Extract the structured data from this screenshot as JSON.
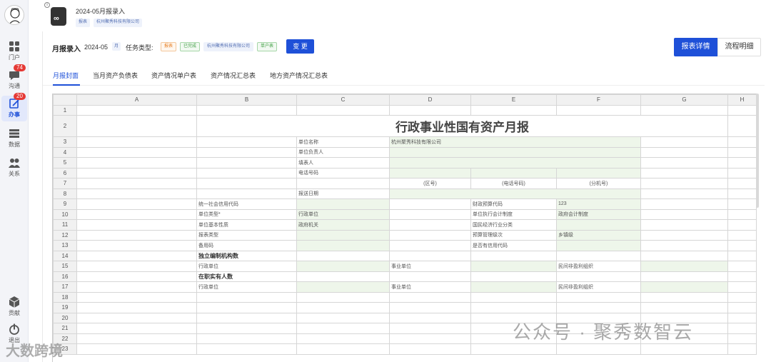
{
  "sidebar": {
    "items": [
      {
        "label": "门户",
        "icon": "grid-icon"
      },
      {
        "label": "沟通",
        "icon": "chat-icon",
        "badge": "74"
      },
      {
        "label": "办事",
        "icon": "edit-icon",
        "badge": "20",
        "active": true
      },
      {
        "label": "数据",
        "icon": "database-icon"
      },
      {
        "label": "关系",
        "icon": "people-icon"
      },
      {
        "label": "贡献",
        "icon": "cube-icon"
      },
      {
        "label": "退出",
        "icon": "power-icon"
      }
    ]
  },
  "header": {
    "title": "2024-05月报录入",
    "tags": [
      "报表",
      "杭州聚秀科技有限公司"
    ]
  },
  "toolbar": {
    "title": "月报录入",
    "month": "2024-05",
    "unit": "月",
    "type_label": "任务类型:",
    "tags": [
      {
        "text": "报表",
        "color": "#e67e22"
      },
      {
        "text": "已完成",
        "color": "#43a047"
      },
      {
        "text": "杭州聚秀科技有限公司",
        "color": "#5570b3"
      },
      {
        "text": "单户表",
        "color": "#43a047"
      }
    ],
    "change_label": "变 更",
    "detail_label": "报表详情",
    "flow_label": "流程明细"
  },
  "tabs": [
    "月报封面",
    "当月资产负债表",
    "资产情况单户表",
    "资产情况汇总表",
    "地方资产情况汇总表"
  ],
  "sheet": {
    "columns": [
      "",
      "A",
      "B",
      "C",
      "D",
      "E",
      "F",
      "G",
      "H"
    ],
    "title": "行政事业性国有资产月报",
    "labels": {
      "unit_name": "单位名称",
      "unit_name_value": "杭州聚秀科技有限公司",
      "unit_head": "单位负责人",
      "filler": "填表人",
      "phone": "电话号码",
      "area_code": "(区号)",
      "phone_no": "(电话号码)",
      "ext": "(分机号)",
      "send_date": "报送日期",
      "credit_code": "统一社会信用代码",
      "budget_code": "财政预算代码",
      "budget_code_value": "123",
      "unit_type": "单位类型*",
      "unit_type_value": "行政单位",
      "accounting": "单位执行会计制度",
      "accounting_value": "政府会计制度",
      "unit_nature": "单位基本性质",
      "unit_nature_value": "政府机关",
      "industry": "国民经济行业分类",
      "report_type": "报表类型",
      "budget_level": "预算管理级次",
      "budget_level_value": "乡镇级",
      "backup_code": "备用码",
      "has_credit": "是否有信用代码",
      "independent": "独立编制机构数",
      "admin_unit": "行政单位",
      "public_unit": "事业单位",
      "ngo": "民间非盈利组织",
      "staff": "在职实有人数"
    }
  },
  "watermark": {
    "right": "公众号 · 聚秀数智云",
    "left": "大数跨境"
  }
}
